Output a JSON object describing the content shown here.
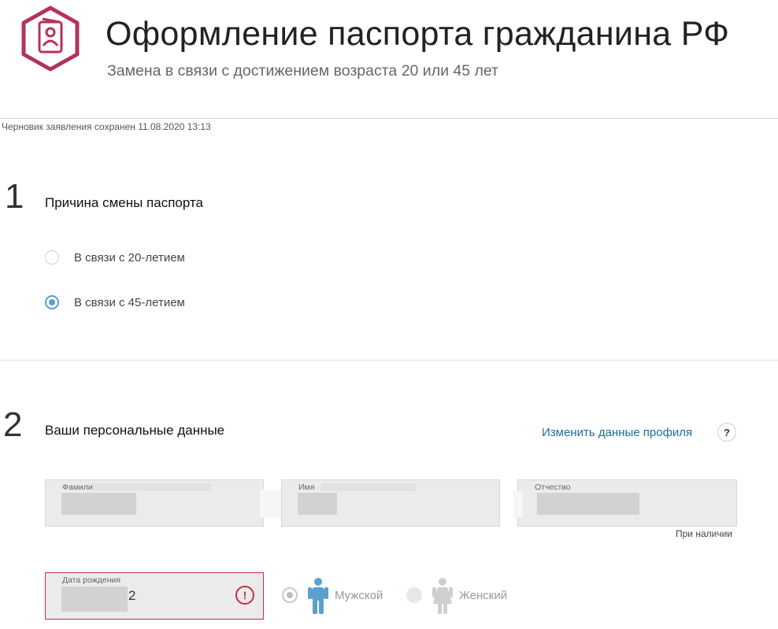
{
  "header": {
    "title": "Оформление паспорта гражданина РФ",
    "subtitle": "Замена в связи с достижением возраста 20 или 45 лет",
    "draft_note": "Черновик заявления сохранен 11.08.2020 13:13",
    "logo_icon": "passport-icon",
    "brand_color": "#b5325a"
  },
  "section1": {
    "number": "1",
    "title": "Причина смены паспорта",
    "options": [
      {
        "label": "В связи с 20-летием",
        "checked": false
      },
      {
        "label": "В связи с 45-летием",
        "checked": true
      }
    ],
    "accent_color": "#5aa0cc"
  },
  "section2": {
    "number": "2",
    "title": "Ваши персональные данные",
    "edit_link": "Изменить данные профиля",
    "help_label": "?",
    "fields": {
      "surname": {
        "label": "Фамилия"
      },
      "name": {
        "label": "Имя"
      },
      "patronymic": {
        "label": "Отчество",
        "hint": "При наличии"
      },
      "birthdate": {
        "label": "Дата рождения",
        "visible_suffix": "2",
        "error_icon": "!",
        "error_color": "#c0314a"
      }
    },
    "gender": {
      "options": [
        {
          "label": "Мужской",
          "icon": "male-figure-icon",
          "checked": true
        },
        {
          "label": "Женский",
          "icon": "female-figure-icon",
          "checked": false
        }
      ]
    }
  }
}
